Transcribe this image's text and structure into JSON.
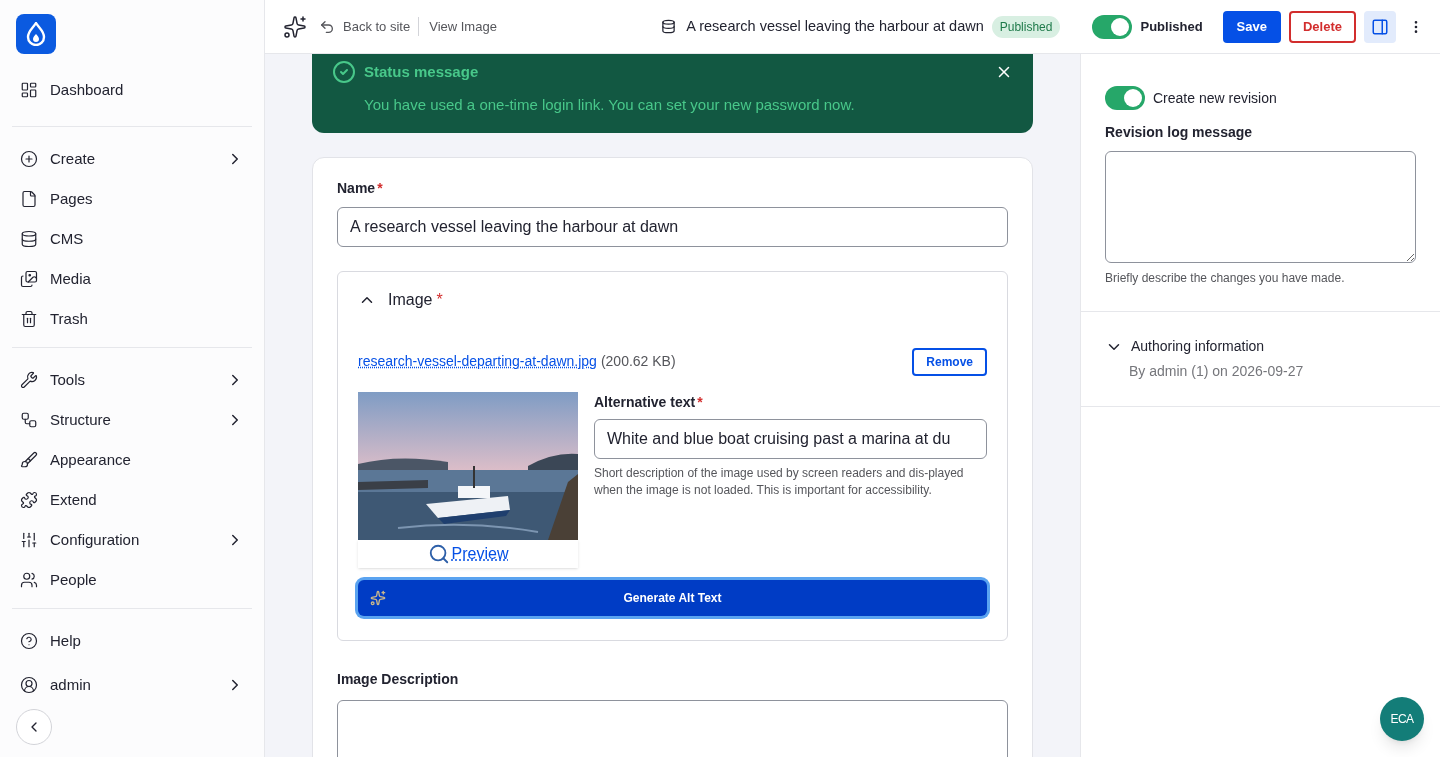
{
  "sidebar": {
    "groups": [
      [
        {
          "label": "Dashboard",
          "has_submenu": false
        }
      ],
      [
        {
          "label": "Create",
          "has_submenu": true
        },
        {
          "label": "Pages",
          "has_submenu": false
        },
        {
          "label": "CMS",
          "has_submenu": false
        },
        {
          "label": "Media",
          "has_submenu": false
        },
        {
          "label": "Trash",
          "has_submenu": false
        }
      ],
      [
        {
          "label": "Tools",
          "has_submenu": true
        },
        {
          "label": "Structure",
          "has_submenu": true
        },
        {
          "label": "Appearance",
          "has_submenu": false
        },
        {
          "label": "Extend",
          "has_submenu": false
        },
        {
          "label": "Configuration",
          "has_submenu": true
        },
        {
          "label": "People",
          "has_submenu": false
        }
      ]
    ],
    "footer": [
      {
        "label": "Help",
        "has_submenu": false
      },
      {
        "label": "admin",
        "has_submenu": true
      }
    ]
  },
  "header": {
    "back": "Back to site",
    "view": "View Image",
    "title": "A research vessel leaving the harbour at dawn",
    "status_badge": "Published",
    "published_toggle": {
      "label": "Published",
      "on": true
    },
    "save": "Save",
    "delete": "Delete"
  },
  "status_message": {
    "title": "Status message",
    "text": "You have used a one-time login link. You can set your new password now."
  },
  "form": {
    "name_label": "Name",
    "name_required": "*",
    "name_value": "A research vessel leaving the harbour at dawn",
    "image_section": {
      "title": "Image",
      "title_required": "*",
      "expanded": true,
      "file_link": "research-vessel-departing-at-dawn.jpg",
      "file_size": "(200.62 KB)",
      "remove": "Remove",
      "preview": "Preview",
      "alt_label": "Alternative text",
      "alt_required": "*",
      "alt_value": "White and blue boat cruising past a marina at du",
      "alt_help": "Short description of the image used by screen readers and dis-played when the image is not loaded. This is important for accessibility.",
      "generate": "Generate Alt Text"
    },
    "description_label": "Image Description"
  },
  "side_panel": {
    "revision_toggle": {
      "label": "Create new revision",
      "on": true
    },
    "log_label": "Revision log message",
    "log_help": "Briefly describe the changes you have made.",
    "authoring": {
      "title": "Authoring information",
      "expanded": false,
      "summary": "By admin (1) on 2026-09-27"
    }
  },
  "fab_label": "ECA"
}
